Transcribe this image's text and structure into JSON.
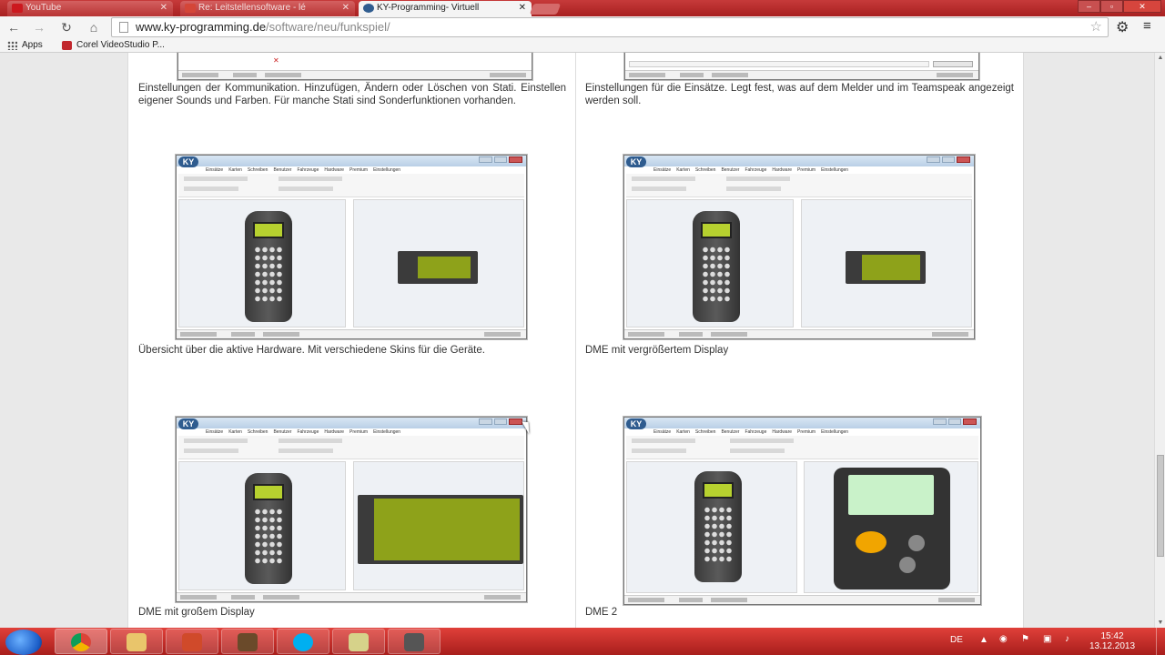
{
  "browser": {
    "tabs": [
      {
        "label": "YouTube",
        "icon": "youtube-icon",
        "icon_color": "#cc181e"
      },
      {
        "label": "Re: Leitstellensoftware - lé",
        "icon": "gmail-icon",
        "icon_color": "#d44638"
      },
      {
        "label": "KY-Programming- Virtuell",
        "icon": "ky-logo-icon",
        "icon_color": "#2f5c8f"
      }
    ],
    "url_host": "www.ky-programming.de",
    "url_path": "/software/neu/funkspiel/",
    "bookmarks": [
      {
        "label": "Apps",
        "icon": "apps-grid-icon"
      },
      {
        "label": "Corel VideoStudio P...",
        "icon": "corel-icon"
      }
    ]
  },
  "page": {
    "captions": {
      "top_left": "Einstellungen der Kommunikation. Hinzufügen, Ändern oder Löschen von Stati. Einstellen eigener Sounds und Farben. Für manche Stati sind Sonderfunktionen vorhanden.",
      "top_right": "Einstellungen für die Einsätze. Legt fest, was auf dem Melder und im Teamspeak angezeigt werden soll.",
      "mid_left": "Übersicht über die aktive Hardware. Mit verschiedene Skins für die Geräte.",
      "mid_right": "DME mit vergrößertem Display",
      "bottom_left": "DME mit großem Display",
      "bottom_right": "DME 2"
    },
    "screenshot_logo": "KY",
    "screenshot_menu": [
      "Einsätze",
      "Karten",
      "Schreiben",
      "Benutzer",
      "Fahrzeuge",
      "Hardware",
      "Premium",
      "Einstellungen"
    ]
  },
  "taskbar": {
    "apps": [
      {
        "name": "chrome",
        "icon": "chrome-icon",
        "color": "#3b8d3b"
      },
      {
        "name": "explorer",
        "icon": "folder-icon",
        "color": "#e9c56b"
      },
      {
        "name": "app-red",
        "icon": "app-icon",
        "color": "#d04a2a"
      },
      {
        "name": "app-photo",
        "icon": "photo-icon",
        "color": "#6a4a2a"
      },
      {
        "name": "skype",
        "icon": "skype-icon",
        "color": "#00aff0"
      },
      {
        "name": "notes",
        "icon": "notes-icon",
        "color": "#d6d28a"
      },
      {
        "name": "ky-app",
        "icon": "ky-app-icon",
        "color": "#555555"
      }
    ],
    "language": "DE",
    "time": "15:42",
    "date": "13.12.2013"
  }
}
